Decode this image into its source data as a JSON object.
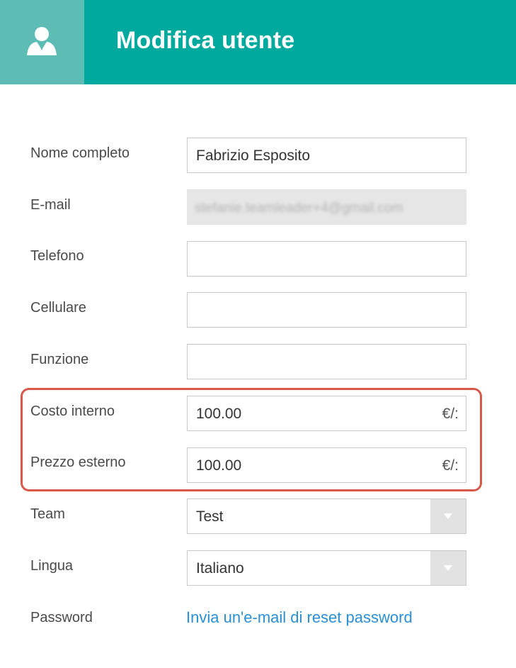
{
  "header": {
    "title": "Modifica utente",
    "icon": "user-icon"
  },
  "form": {
    "nome": {
      "label": "Nome completo",
      "value": "Fabrizio Esposito"
    },
    "email": {
      "label": "E-mail",
      "value": "stefanie.teamleader+4@gmail.com"
    },
    "telefono": {
      "label": "Telefono",
      "value": ""
    },
    "cellulare": {
      "label": "Cellulare",
      "value": ""
    },
    "funzione": {
      "label": "Funzione",
      "value": ""
    },
    "costo": {
      "label": "Costo interno",
      "value": "100.00",
      "unit": "€/:"
    },
    "prezzo": {
      "label": "Prezzo esterno",
      "value": "100.00",
      "unit": "€/:"
    },
    "team": {
      "label": "Team",
      "value": "Test"
    },
    "lingua": {
      "label": "Lingua",
      "value": "Italiano"
    },
    "password": {
      "label": "Password",
      "link": "Invia un'e-mail di reset password"
    }
  },
  "colors": {
    "header": "#00a99d",
    "header_icon_bg": "#5dbcb4",
    "highlight": "#d9584a",
    "link": "#2b8fd6"
  }
}
